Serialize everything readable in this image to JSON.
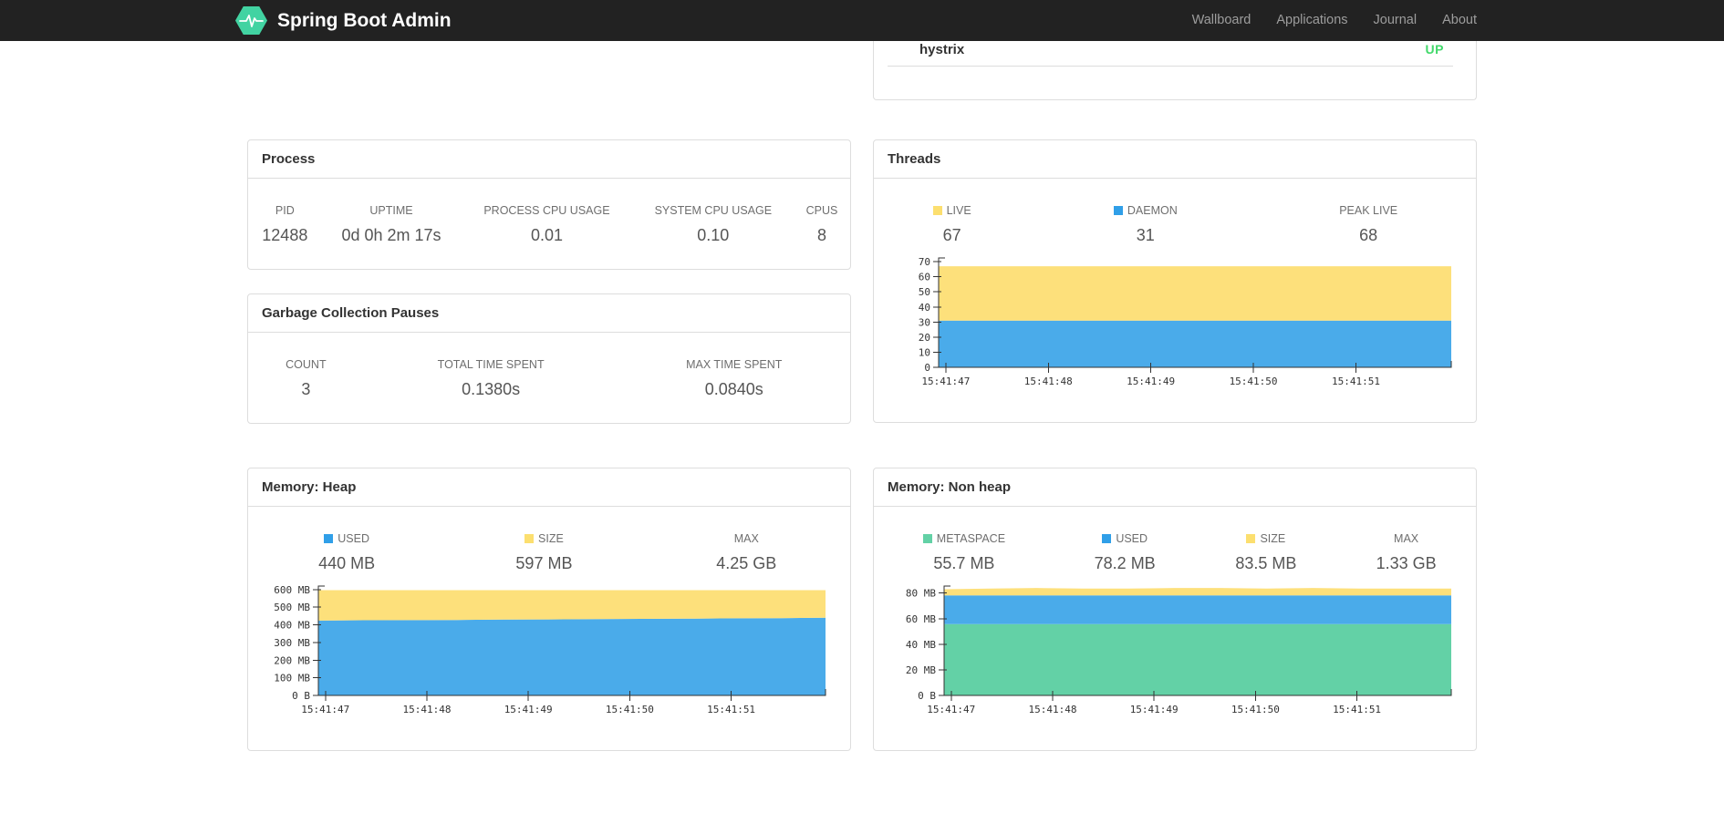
{
  "navbar": {
    "brand": "Spring Boot Admin",
    "brand_color": "#42d3a2",
    "links": [
      {
        "label": "Wallboard"
      },
      {
        "label": "Applications"
      },
      {
        "label": "Journal"
      },
      {
        "label": "About"
      }
    ]
  },
  "health_panel": {
    "item": "hystrix",
    "status": "UP",
    "status_color": "#42d96b"
  },
  "cards": {
    "process": {
      "title": "Process",
      "stats": [
        {
          "label": "PID",
          "value": "12488"
        },
        {
          "label": "UPTIME",
          "value": "0d 0h 2m 17s"
        },
        {
          "label": "PROCESS CPU USAGE",
          "value": "0.01"
        },
        {
          "label": "SYSTEM CPU USAGE",
          "value": "0.10"
        },
        {
          "label": "CPUS",
          "value": "8"
        }
      ]
    },
    "gc": {
      "title": "Garbage Collection Pauses",
      "stats": [
        {
          "label": "COUNT",
          "value": "3"
        },
        {
          "label": "TOTAL TIME SPENT",
          "value": "0.1380s"
        },
        {
          "label": "MAX TIME SPENT",
          "value": "0.0840s"
        }
      ]
    },
    "threads": {
      "title": "Threads",
      "stats": [
        {
          "label": "LIVE",
          "value": "67",
          "color": "#fcdf6f"
        },
        {
          "label": "DAEMON",
          "value": "31",
          "color": "#309fe8"
        },
        {
          "label": "PEAK LIVE",
          "value": "68"
        }
      ]
    },
    "heap": {
      "title": "Memory: Heap",
      "stats": [
        {
          "label": "USED",
          "value": "440 MB",
          "color": "#309fe8"
        },
        {
          "label": "SIZE",
          "value": "597 MB",
          "color": "#fcdf6f"
        },
        {
          "label": "MAX",
          "value": "4.25 GB"
        }
      ]
    },
    "nonheap": {
      "title": "Memory: Non heap",
      "stats": [
        {
          "label": "METASPACE",
          "value": "55.7 MB",
          "color": "#63d1a6"
        },
        {
          "label": "USED",
          "value": "78.2 MB",
          "color": "#309fe8"
        },
        {
          "label": "SIZE",
          "value": "83.5 MB",
          "color": "#fcdf6f"
        },
        {
          "label": "MAX",
          "value": "1.33 GB"
        }
      ]
    }
  },
  "chart_data": [
    {
      "id": "threads",
      "type": "area",
      "title": "Threads",
      "stacked": true,
      "legend": [
        "LIVE",
        "DAEMON",
        "PEAK LIVE"
      ],
      "x_ticks": [
        "15:41:47",
        "15:41:48",
        "15:41:49",
        "15:41:50",
        "15:41:51"
      ],
      "ylim": [
        0,
        72.5
      ],
      "y_ticks": [
        {
          "v": 0,
          "label": "0"
        },
        {
          "v": 10,
          "label": "10"
        },
        {
          "v": 20,
          "label": "20"
        },
        {
          "v": 30,
          "label": "30"
        },
        {
          "v": 40,
          "label": "40"
        },
        {
          "v": 50,
          "label": "50"
        },
        {
          "v": 60,
          "label": "60"
        },
        {
          "v": 70,
          "label": "70"
        }
      ],
      "series": [
        {
          "name": "DAEMON",
          "color": "#4aabea",
          "cumulative_top": [
            31,
            31,
            31,
            31,
            31,
            31,
            31,
            31,
            31,
            31,
            31,
            31
          ]
        },
        {
          "name": "LIVE",
          "color": "#fde07b",
          "cumulative_top": [
            67,
            67,
            67,
            67,
            67,
            67,
            67,
            67,
            67,
            67,
            67,
            67
          ]
        }
      ]
    },
    {
      "id": "heap",
      "type": "area",
      "title": "Memory: Heap",
      "stacked": true,
      "legend": [
        "USED",
        "SIZE",
        "MAX"
      ],
      "x_ticks": [
        "15:41:47",
        "15:41:48",
        "15:41:49",
        "15:41:50",
        "15:41:51"
      ],
      "ylim": [
        0,
        620
      ],
      "y_ticks": [
        {
          "v": 0,
          "label": "0 B"
        },
        {
          "v": 100,
          "label": "100 MB"
        },
        {
          "v": 200,
          "label": "200 MB"
        },
        {
          "v": 300,
          "label": "300 MB"
        },
        {
          "v": 400,
          "label": "400 MB"
        },
        {
          "v": 500,
          "label": "500 MB"
        },
        {
          "v": 600,
          "label": "600 MB"
        }
      ],
      "series": [
        {
          "name": "USED",
          "color": "#4aabea",
          "cumulative_top": [
            424,
            426,
            427,
            428,
            430,
            431,
            433,
            434,
            435,
            437,
            438,
            440
          ]
        },
        {
          "name": "SIZE",
          "color": "#fde07b",
          "cumulative_top": [
            597,
            597,
            597,
            597,
            597,
            597,
            597,
            597,
            597,
            597,
            597,
            597
          ]
        }
      ]
    },
    {
      "id": "nonheap",
      "type": "area",
      "title": "Memory: Non heap",
      "stacked": true,
      "legend": [
        "METASPACE",
        "USED",
        "SIZE",
        "MAX"
      ],
      "x_ticks": [
        "15:41:47",
        "15:41:48",
        "15:41:49",
        "15:41:50",
        "15:41:51"
      ],
      "ylim": [
        0,
        85.5
      ],
      "y_ticks": [
        {
          "v": 0,
          "label": "0 B"
        },
        {
          "v": 20,
          "label": "20 MB"
        },
        {
          "v": 40,
          "label": "40 MB"
        },
        {
          "v": 60,
          "label": "60 MB"
        },
        {
          "v": 80,
          "label": "80 MB"
        }
      ],
      "series": [
        {
          "name": "METASPACE",
          "color": "#63d1a6",
          "cumulative_top": [
            55.7,
            55.7,
            55.7,
            55.7,
            55.7,
            55.7,
            55.7,
            55.7,
            55.7,
            55.7,
            55.7,
            55.7
          ]
        },
        {
          "name": "USED",
          "color": "#4aabea",
          "cumulative_top": [
            78.2,
            78.2,
            78.2,
            78.2,
            78.2,
            78.2,
            78.2,
            78.2,
            78.2,
            78.2,
            78.2,
            78.2
          ]
        },
        {
          "name": "SIZE",
          "color": "#fde07b",
          "cumulative_top": [
            83,
            83.5,
            84,
            83.5,
            83.5,
            84,
            84,
            83.5,
            84,
            83.5,
            83.5,
            83.5
          ]
        }
      ]
    }
  ]
}
